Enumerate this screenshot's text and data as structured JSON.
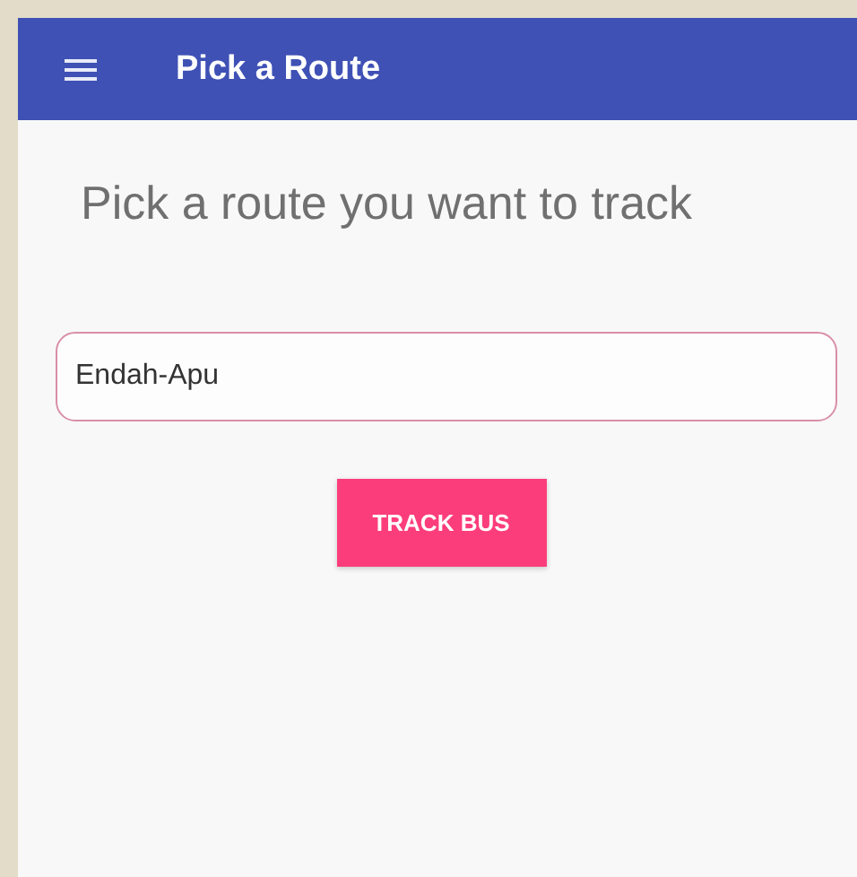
{
  "app_bar": {
    "title": "Pick a Route"
  },
  "heading": "Pick a route you want to track",
  "route_field": {
    "value": "Endah-Apu"
  },
  "buttons": [
    "TRACK BUS"
  ]
}
